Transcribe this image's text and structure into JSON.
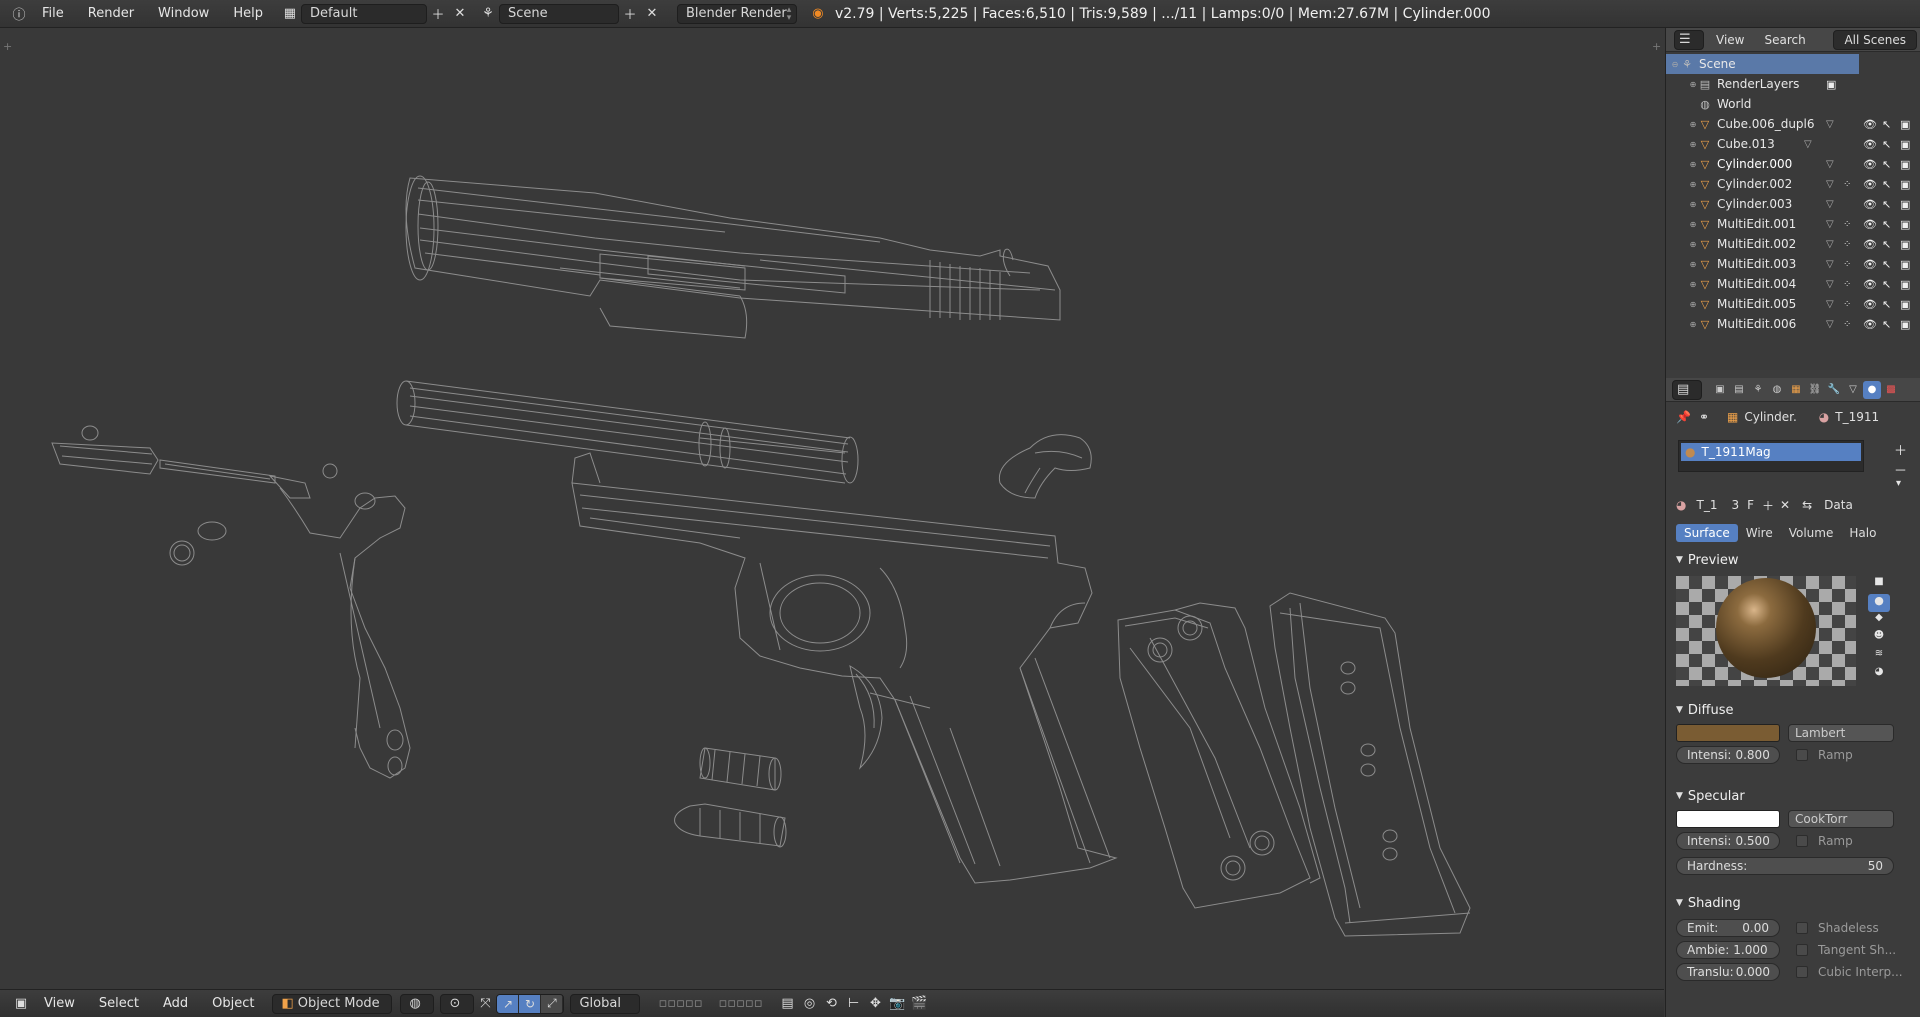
{
  "topbar": {
    "menus": [
      "File",
      "Render",
      "Window",
      "Help"
    ],
    "layout": "Default",
    "scene": "Scene",
    "engine": "Blender Render",
    "stats": "v2.79 | Verts:5,225 | Faces:6,510 | Tris:9,589 | .../11 | Lamps:0/0 | Mem:27.67M | Cylinder.000"
  },
  "bottombar": {
    "menus": [
      "View",
      "Select",
      "Add",
      "Object"
    ],
    "mode": "Object Mode",
    "orientation": "Global"
  },
  "outliner": {
    "tabs": [
      "View",
      "Search"
    ],
    "display": "All Scenes",
    "scene": "Scene",
    "scene_children": [
      "RenderLayers",
      "World"
    ],
    "objects": [
      {
        "name": "Cube.006_dupl6",
        "modifier": false
      },
      {
        "name": "Cube.013",
        "modifier": false
      },
      {
        "name": "Cylinder.000",
        "modifier": false,
        "active": true
      },
      {
        "name": "Cylinder.002",
        "modifier": true
      },
      {
        "name": "Cylinder.003",
        "modifier": false
      },
      {
        "name": "MultiEdit.001",
        "modifier": true
      },
      {
        "name": "MultiEdit.002",
        "modifier": true
      },
      {
        "name": "MultiEdit.003",
        "modifier": true
      },
      {
        "name": "MultiEdit.004",
        "modifier": true
      },
      {
        "name": "MultiEdit.005",
        "modifier": true
      },
      {
        "name": "MultiEdit.006",
        "modifier": true
      }
    ]
  },
  "properties": {
    "breadcrumb_object": "Cylinder.",
    "breadcrumb_material": "T_1911",
    "slot_name": "T_1911Mag",
    "material_short": "T_1",
    "user_count": "3",
    "fake_user": "F",
    "link": "Data",
    "tabs": [
      "Surface",
      "Wire",
      "Volume",
      "Halo"
    ],
    "active_tab": "Surface",
    "preview_title": "Preview",
    "diffuse": {
      "title": "Diffuse",
      "shader": "Lambert",
      "intensity_label": "Intensi:",
      "intensity": "0.800",
      "ramp": "Ramp",
      "color": "#7a5c33"
    },
    "specular": {
      "title": "Specular",
      "shader": "CookTorr",
      "intensity_label": "Intensi:",
      "intensity": "0.500",
      "ramp": "Ramp",
      "color": "#ffffff",
      "hardness_label": "Hardness:",
      "hardness": "50"
    },
    "shading": {
      "title": "Shading",
      "emit_label": "Emit:",
      "emit": "0.00",
      "ambient_label": "Ambie:",
      "ambient": "1.000",
      "translucency_label": "Translu:",
      "translucency": "0.000",
      "shadeless": "Shadeless",
      "tangent": "Tangent Sh...",
      "cubic": "Cubic Interp..."
    }
  },
  "colors": {
    "viewport": "#393939",
    "selection": "#5680c2",
    "wire": "#8a8a8a",
    "object_icon": "#f0a24a"
  }
}
